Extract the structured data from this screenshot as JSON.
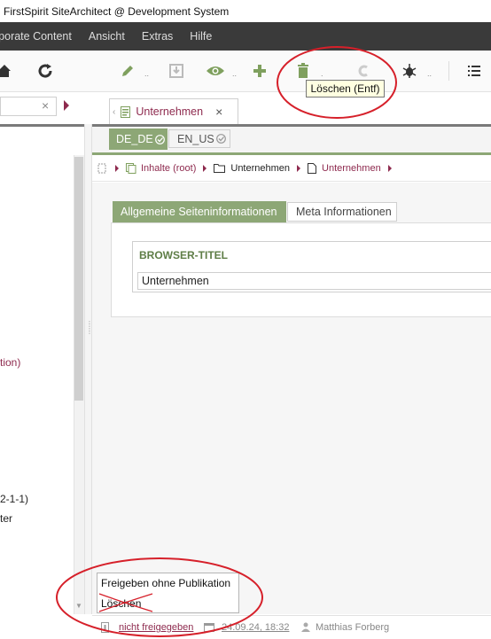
{
  "window": {
    "title": "FirstSpirit SiteArchitect @ Development System"
  },
  "menu": {
    "items": [
      "rporate Content",
      "Ansicht",
      "Extras",
      "Hilfe"
    ]
  },
  "toolbar": {
    "tooltip": "Löschen (Entf)",
    "icons": [
      "home-icon",
      "refresh-icon",
      "edit-icon",
      "save-icon",
      "preview-icon",
      "add-icon",
      "delete-icon",
      "clipboard-icon",
      "debug-icon",
      "list-icon"
    ]
  },
  "left_panel": {
    "visible_fragments": [
      "tion)",
      "2-1-1)",
      "ter"
    ]
  },
  "document_tab": {
    "label": "Unternehmen"
  },
  "languages": {
    "active": "DE_DE",
    "inactive": "EN_US"
  },
  "breadcrumb": {
    "items": [
      {
        "label": "Inhalte (root)"
      },
      {
        "label": "Unternehmen"
      },
      {
        "label": "Unternehmen"
      }
    ]
  },
  "form": {
    "tabs": [
      "Allgemeine Seiteninformationen",
      "Meta Informationen"
    ],
    "fields": [
      {
        "label": "BROWSER-TITEL",
        "value": "Unternehmen"
      }
    ]
  },
  "popup_menu": {
    "items": [
      "Freigeben ohne Publikation",
      "Löschen"
    ]
  },
  "status": {
    "release_state": "nicht freigegeben",
    "date": "24.09.24, 18:32",
    "user": "Matthias Forberg"
  },
  "colors": {
    "accent_green": "#8da776",
    "accent_red": "#8e2a4e",
    "annotation_red": "#d6202a",
    "menubar_bg": "#3a3a3a"
  }
}
